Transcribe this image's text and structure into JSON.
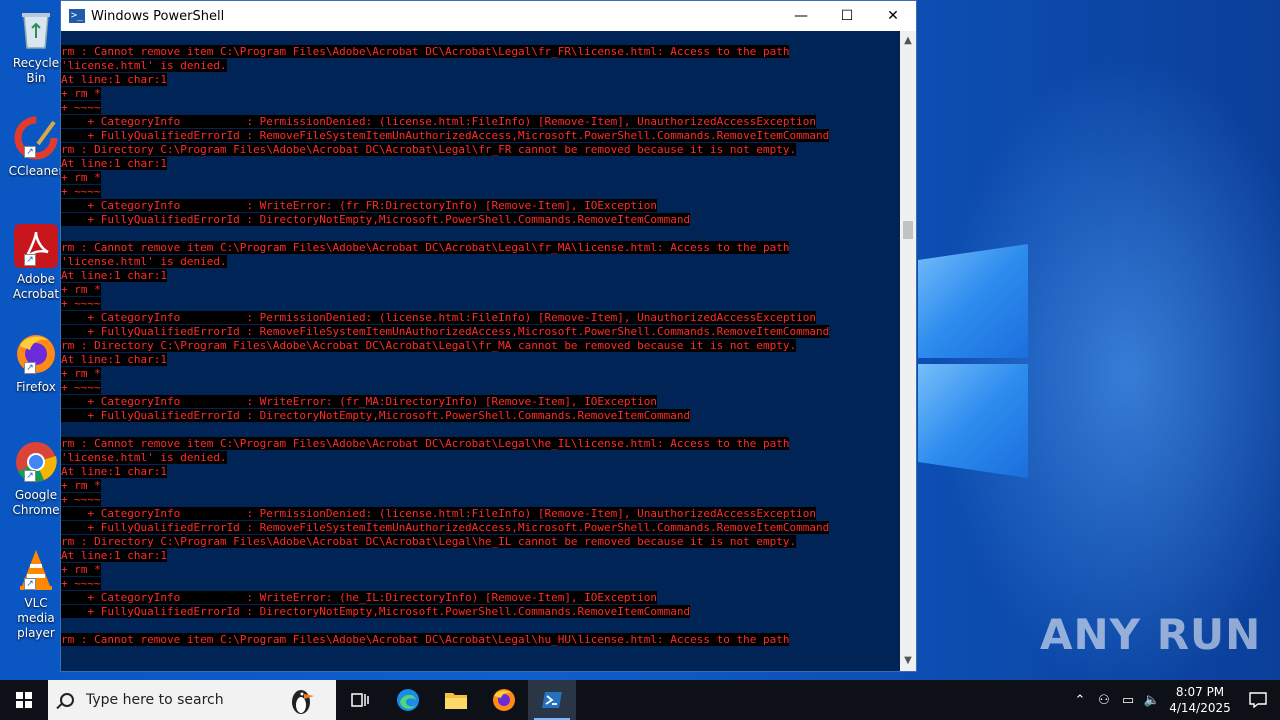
{
  "desktop": {
    "icons": [
      {
        "label": "Recycle Bin"
      },
      {
        "label": "CCleaner"
      },
      {
        "label": "Adobe Acrobat"
      },
      {
        "label": "Firefox"
      },
      {
        "label": "Google Chrome"
      },
      {
        "label": "VLC media player"
      }
    ],
    "watermark": "ANY RUN"
  },
  "window": {
    "title": "Windows PowerShell",
    "icon": "powershell-icon",
    "controls": {
      "minimize": "—",
      "maximize": "☐",
      "close": "✕"
    },
    "console_lines": [
      "rm : Cannot remove item C:\\Program Files\\Adobe\\Acrobat DC\\Acrobat\\Legal\\fr_FR\\license.html: Access to the path",
      "'license.html' is denied.",
      "At line:1 char:1",
      "+ rm *",
      "+ ~~~~",
      "    + CategoryInfo          : PermissionDenied: (license.html:FileInfo) [Remove-Item], UnauthorizedAccessException",
      "    + FullyQualifiedErrorId : RemoveFileSystemItemUnAuthorizedAccess,Microsoft.PowerShell.Commands.RemoveItemCommand",
      "rm : Directory C:\\Program Files\\Adobe\\Acrobat DC\\Acrobat\\Legal\\fr_FR cannot be removed because it is not empty.",
      "At line:1 char:1",
      "+ rm *",
      "+ ~~~~",
      "    + CategoryInfo          : WriteError: (fr_FR:DirectoryInfo) [Remove-Item], IOException",
      "    + FullyQualifiedErrorId : DirectoryNotEmpty,Microsoft.PowerShell.Commands.RemoveItemCommand",
      "",
      "rm : Cannot remove item C:\\Program Files\\Adobe\\Acrobat DC\\Acrobat\\Legal\\fr_MA\\license.html: Access to the path",
      "'license.html' is denied.",
      "At line:1 char:1",
      "+ rm *",
      "+ ~~~~",
      "    + CategoryInfo          : PermissionDenied: (license.html:FileInfo) [Remove-Item], UnauthorizedAccessException",
      "    + FullyQualifiedErrorId : RemoveFileSystemItemUnAuthorizedAccess,Microsoft.PowerShell.Commands.RemoveItemCommand",
      "rm : Directory C:\\Program Files\\Adobe\\Acrobat DC\\Acrobat\\Legal\\fr_MA cannot be removed because it is not empty.",
      "At line:1 char:1",
      "+ rm *",
      "+ ~~~~",
      "    + CategoryInfo          : WriteError: (fr_MA:DirectoryInfo) [Remove-Item], IOException",
      "    + FullyQualifiedErrorId : DirectoryNotEmpty,Microsoft.PowerShell.Commands.RemoveItemCommand",
      "",
      "rm : Cannot remove item C:\\Program Files\\Adobe\\Acrobat DC\\Acrobat\\Legal\\he_IL\\license.html: Access to the path",
      "'license.html' is denied.",
      "At line:1 char:1",
      "+ rm *",
      "+ ~~~~",
      "    + CategoryInfo          : PermissionDenied: (license.html:FileInfo) [Remove-Item], UnauthorizedAccessException",
      "    + FullyQualifiedErrorId : RemoveFileSystemItemUnAuthorizedAccess,Microsoft.PowerShell.Commands.RemoveItemCommand",
      "rm : Directory C:\\Program Files\\Adobe\\Acrobat DC\\Acrobat\\Legal\\he_IL cannot be removed because it is not empty.",
      "At line:1 char:1",
      "+ rm *",
      "+ ~~~~",
      "    + CategoryInfo          : WriteError: (he_IL:DirectoryInfo) [Remove-Item], IOException",
      "    + FullyQualifiedErrorId : DirectoryNotEmpty,Microsoft.PowerShell.Commands.RemoveItemCommand",
      "",
      "rm : Cannot remove item C:\\Program Files\\Adobe\\Acrobat DC\\Acrobat\\Legal\\hu_HU\\license.html: Access to the path",
      ""
    ]
  },
  "taskbar": {
    "search_placeholder": "Type here to search",
    "apps": [
      "task-view-icon",
      "edge-icon",
      "file-explorer-icon",
      "firefox-icon",
      "powershell-icon"
    ],
    "clock_time": "8:07 PM",
    "clock_date": "4/14/2025"
  },
  "colors": {
    "console_bg": "#012456",
    "error_fg": "#ff2b2b",
    "error_bg": "#000000"
  }
}
